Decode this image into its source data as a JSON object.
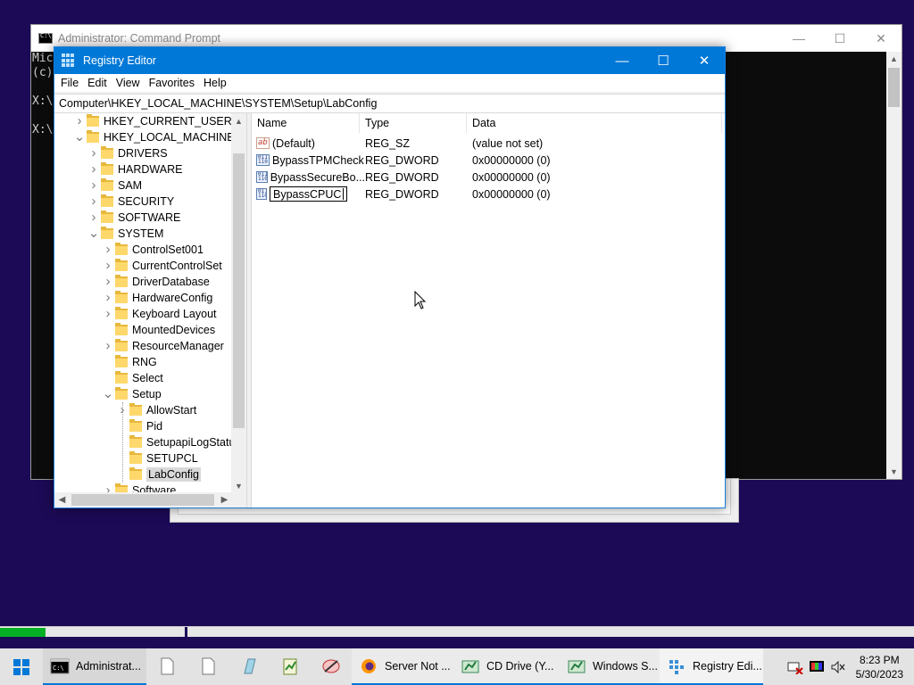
{
  "cmd": {
    "title": "Administrator: Command Prompt",
    "lines": [
      "Mic",
      "(c)",
      "",
      "X:\\",
      "",
      "X:\\"
    ],
    "controls": {
      "minimize": "—",
      "maximize": "☐",
      "close": "✕"
    }
  },
  "regedit": {
    "title": "Registry Editor",
    "controls": {
      "minimize": "—",
      "maximize": "☐",
      "close": "✕"
    },
    "menu": {
      "file": "File",
      "edit": "Edit",
      "view": "View",
      "favorites": "Favorites",
      "help": "Help"
    },
    "address": "Computer\\HKEY_LOCAL_MACHINE\\SYSTEM\\Setup\\LabConfig",
    "tree": [
      {
        "label": "HKEY_CURRENT_USER",
        "exp": ">"
      },
      {
        "label": "HKEY_LOCAL_MACHINE",
        "exp": "v"
      },
      {
        "label": "DRIVERS",
        "exp": ">"
      },
      {
        "label": "HARDWARE",
        "exp": ">"
      },
      {
        "label": "SAM",
        "exp": ">"
      },
      {
        "label": "SECURITY",
        "exp": ">"
      },
      {
        "label": "SOFTWARE",
        "exp": ">"
      },
      {
        "label": "SYSTEM",
        "exp": "v"
      },
      {
        "label": "ControlSet001",
        "exp": ">"
      },
      {
        "label": "CurrentControlSet",
        "exp": ">"
      },
      {
        "label": "DriverDatabase",
        "exp": ">"
      },
      {
        "label": "HardwareConfig",
        "exp": ">"
      },
      {
        "label": "Keyboard Layout",
        "exp": ">"
      },
      {
        "label": "MountedDevices",
        "exp": ""
      },
      {
        "label": "ResourceManager",
        "exp": ">"
      },
      {
        "label": "RNG",
        "exp": ""
      },
      {
        "label": "Select",
        "exp": ""
      },
      {
        "label": "Setup",
        "exp": "v"
      },
      {
        "label": "AllowStart",
        "exp": ">"
      },
      {
        "label": "Pid",
        "exp": ""
      },
      {
        "label": "SetupapiLogStatu",
        "exp": ""
      },
      {
        "label": "SETUPCL",
        "exp": ""
      },
      {
        "label": "LabConfig",
        "exp": ""
      },
      {
        "label": "Software",
        "exp": ">"
      }
    ],
    "columns": {
      "name": "Name",
      "type": "Type",
      "data": "Data"
    },
    "values": [
      {
        "name": "(Default)",
        "type": "REG_SZ",
        "data": "(value not set)",
        "icon": "ab"
      },
      {
        "name": "BypassTPMCheck",
        "type": "REG_DWORD",
        "data": "0x00000000 (0)",
        "icon": "011 110"
      },
      {
        "name": "BypassSecureBo...",
        "type": "REG_DWORD",
        "data": "0x00000000 (0)",
        "icon": "011 110"
      },
      {
        "name": "BypassCPUC",
        "type": "REG_DWORD",
        "data": "0x00000000 (0)",
        "icon": "011 110"
      }
    ]
  },
  "progress": {
    "fraction": 0.05
  },
  "taskbar": {
    "items": [
      {
        "label": "Administrat..."
      },
      {
        "label": ""
      },
      {
        "label": ""
      },
      {
        "label": ""
      },
      {
        "label": ""
      },
      {
        "label": ""
      },
      {
        "label": "Server Not ..."
      },
      {
        "label": "CD Drive (Y..."
      },
      {
        "label": "Windows S..."
      },
      {
        "label": "Registry Edi..."
      }
    ],
    "time": "8:23 PM",
    "date": "5/30/2023"
  },
  "colors": {
    "accent": "#0078d7",
    "desktop": "#1c0a56",
    "progress": "#06b025"
  }
}
